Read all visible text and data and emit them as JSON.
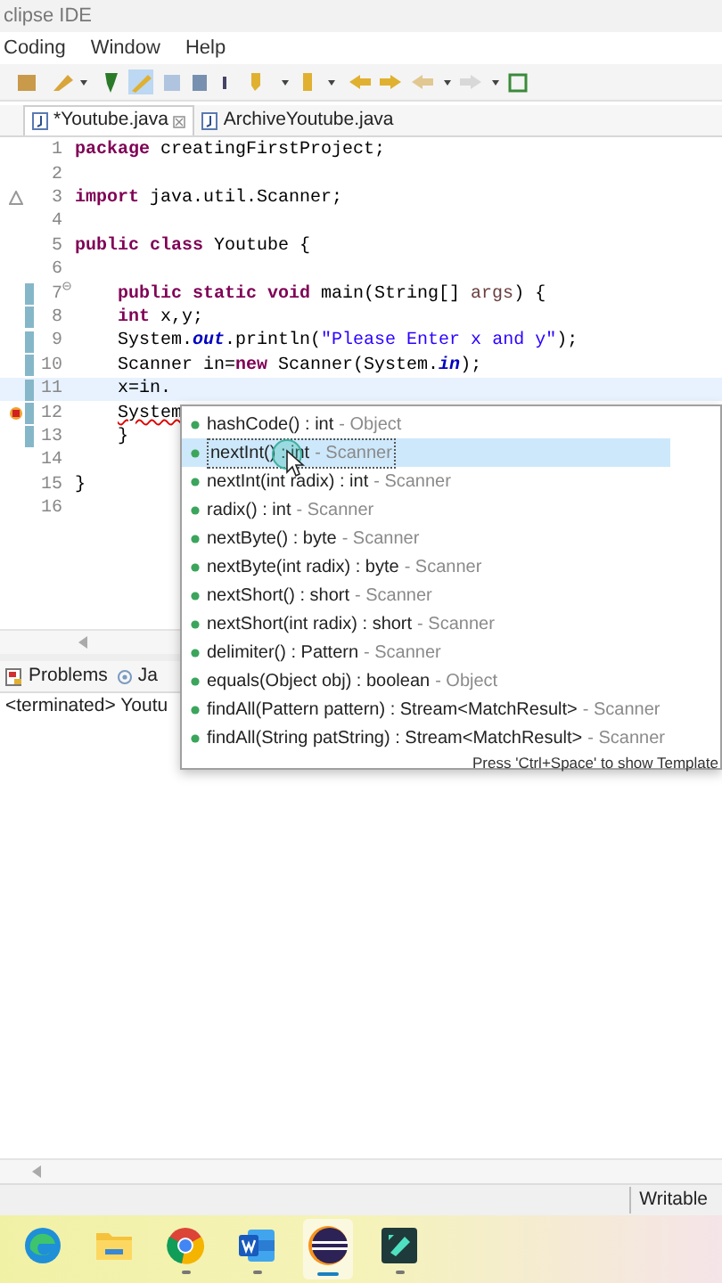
{
  "window": {
    "title": "clipse IDE"
  },
  "menu": [
    "Coding",
    "Window",
    "Help"
  ],
  "editor_tabs": [
    {
      "label": "*Youtube.java",
      "selected": true,
      "closable": true
    },
    {
      "label": "ArchiveYoutube.java",
      "selected": false
    }
  ],
  "code_lines": [
    {
      "number": "1",
      "tokens": [
        {
          "kind": "keyword",
          "text": "package"
        },
        {
          "kind": "plain",
          "text": " creatingFirstProject;"
        }
      ]
    },
    {
      "number": "2"
    },
    {
      "number": "3",
      "warning": true,
      "tokens": [
        {
          "kind": "keyword",
          "text": "import"
        },
        {
          "kind": "plain",
          "text": " java.util.Scanner;"
        }
      ]
    },
    {
      "number": "4"
    },
    {
      "number": "5",
      "tokens": [
        {
          "kind": "keyword",
          "text": "public class"
        },
        {
          "kind": "plain",
          "text": " Youtube {"
        }
      ]
    },
    {
      "number": "6"
    },
    {
      "number": "7",
      "changed": true,
      "fold": true,
      "indented": true,
      "tokens": [
        {
          "kind": "keyword",
          "text": "public static void"
        },
        {
          "kind": "plain",
          "text": " main(String[] "
        },
        {
          "kind": "param",
          "text": "args"
        },
        {
          "kind": "plain",
          "text": ") {"
        }
      ]
    },
    {
      "number": "8",
      "changed": true,
      "indented": true,
      "tokens": [
        {
          "kind": "keyword",
          "text": "int"
        },
        {
          "kind": "plain",
          "text": " x,y;"
        }
      ]
    },
    {
      "number": "9",
      "changed": true,
      "indented": true,
      "tokens": [
        {
          "kind": "plain",
          "text": "System."
        },
        {
          "kind": "field",
          "text": "out"
        },
        {
          "kind": "plain",
          "text": ".println("
        },
        {
          "kind": "string",
          "text": "\"Please Enter x and y\""
        },
        {
          "kind": "plain",
          "text": ");"
        }
      ]
    },
    {
      "number": "10",
      "changed": true,
      "indented": true,
      "tokens": [
        {
          "kind": "plain",
          "text": "Scanner in="
        },
        {
          "kind": "keyword",
          "text": "new"
        },
        {
          "kind": "plain",
          "text": " Scanner(System."
        },
        {
          "kind": "field",
          "text": "in"
        },
        {
          "kind": "plain",
          "text": ");"
        }
      ]
    },
    {
      "number": "11",
      "changed": true,
      "current": true,
      "indented": true,
      "tokens": [
        {
          "kind": "plain",
          "text": "x=in."
        }
      ]
    },
    {
      "number": "12",
      "error": true,
      "changed": true,
      "indented": true,
      "tokens": [
        {
          "kind": "error",
          "text": "System"
        }
      ]
    },
    {
      "number": "13",
      "changed": true,
      "indented": true,
      "tokens": [
        {
          "kind": "plain",
          "text": "}"
        }
      ]
    },
    {
      "number": "14"
    },
    {
      "number": "15",
      "tokens": [
        {
          "kind": "plain",
          "text": "}"
        }
      ]
    },
    {
      "number": "16"
    }
  ],
  "completion": {
    "items": [
      {
        "signature": "hashCode() : int",
        "owner": "- Object",
        "selected": false
      },
      {
        "signature": "nextInt() : int",
        "owner": "- Scanner",
        "selected": true
      },
      {
        "signature": "nextInt(int radix) : int",
        "owner": "- Scanner",
        "selected": false
      },
      {
        "signature": "radix() : int",
        "owner": "- Scanner",
        "selected": false
      },
      {
        "signature": "nextByte() : byte",
        "owner": "- Scanner",
        "selected": false
      },
      {
        "signature": "nextByte(int radix) : byte",
        "owner": "- Scanner",
        "selected": false
      },
      {
        "signature": "nextShort() : short",
        "owner": "- Scanner",
        "selected": false
      },
      {
        "signature": "nextShort(int radix) : short",
        "owner": "- Scanner",
        "selected": false
      },
      {
        "signature": "delimiter() : Pattern",
        "owner": "- Scanner",
        "selected": false
      },
      {
        "signature": "equals(Object obj) : boolean",
        "owner": "- Object",
        "selected": false
      },
      {
        "signature": "findAll(Pattern pattern) : Stream<MatchResult>",
        "owner": "- Scanner",
        "selected": false
      },
      {
        "signature": "findAll(String patString) : Stream<MatchResult>",
        "owner": "- Scanner",
        "selected": false
      }
    ],
    "footer": "Press 'Ctrl+Space' to show Template"
  },
  "bottom_tabs": [
    {
      "label": "Problems",
      "kind": "problems"
    },
    {
      "label": "Ja",
      "kind": "javadoc"
    }
  ],
  "console": {
    "text": "<terminated> Youtu"
  },
  "status_bar": {
    "mode": "Writable"
  },
  "taskbar": [
    {
      "kind": "edge"
    },
    {
      "kind": "files"
    },
    {
      "kind": "chrome",
      "running": true
    },
    {
      "kind": "word",
      "running": true
    },
    {
      "kind": "eclipse",
      "running": true,
      "active": true
    },
    {
      "kind": "filmora",
      "running": true
    }
  ]
}
